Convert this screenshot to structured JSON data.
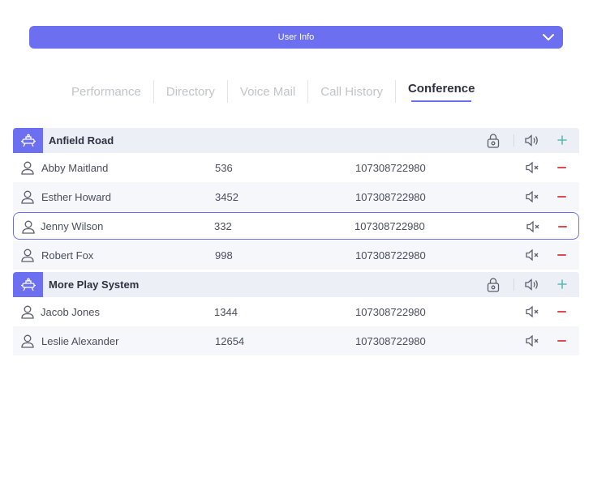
{
  "header": {
    "title": "User Info",
    "icon": "chevron-down-icon"
  },
  "tabs": [
    {
      "label": "Performance",
      "active": false
    },
    {
      "label": "Directory",
      "active": false
    },
    {
      "label": "Voice Mail",
      "active": false
    },
    {
      "label": "Call History",
      "active": false
    },
    {
      "label": "Conference",
      "active": true
    }
  ],
  "colors": {
    "accent": "#6b6ff0",
    "remove": "#e0494e",
    "add": "#5fb8b0"
  },
  "groups": [
    {
      "name": "Anfield Road",
      "members": [
        {
          "name": "Abby Maitland",
          "ext": "536",
          "number": "107308722980",
          "selected": false
        },
        {
          "name": "Esther Howard",
          "ext": "3452",
          "number": "107308722980",
          "selected": false
        },
        {
          "name": "Jenny Wilson",
          "ext": "332",
          "number": "107308722980",
          "selected": true
        },
        {
          "name": "Robert Fox",
          "ext": "998",
          "number": "107308722980",
          "selected": false
        }
      ]
    },
    {
      "name": "More Play System",
      "members": [
        {
          "name": "Jacob Jones",
          "ext": "1344",
          "number": "107308722980",
          "selected": false
        },
        {
          "name": "Leslie Alexander",
          "ext": "12654",
          "number": "107308722980",
          "selected": false
        }
      ]
    }
  ]
}
